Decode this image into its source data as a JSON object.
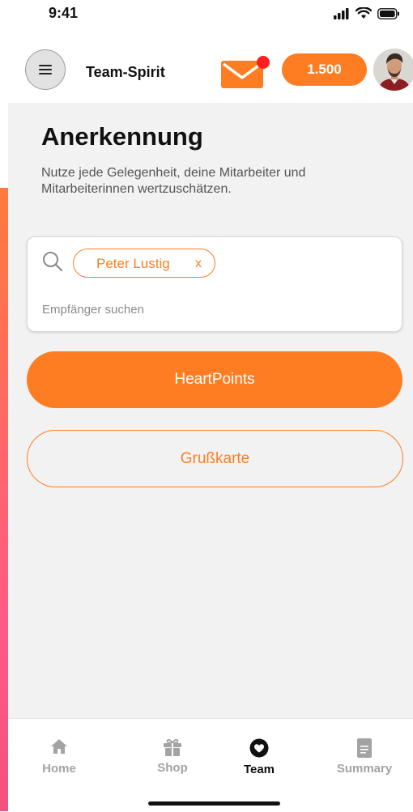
{
  "status_bar": {
    "time": "9:41"
  },
  "header": {
    "app_title": "Team-Spirit",
    "points_balance": "1.500",
    "has_unread_mail": true
  },
  "page": {
    "title": "Anerkennung",
    "description": "Nutze jede Gelegenheit, deine Mitarbeiter und Mitarbeiterinnen wertzuschätzen."
  },
  "recipient_search": {
    "selected_chip": {
      "label": "Peter Lustig",
      "remove": "x"
    },
    "placeholder": "Empfänger suchen",
    "value": ""
  },
  "actions": {
    "primary_label": "HeartPoints",
    "secondary_label": "Grußkarte"
  },
  "bottom_nav": {
    "items": [
      {
        "label": "Home",
        "icon": "home-icon",
        "active": false
      },
      {
        "label": "Shop",
        "icon": "gift-icon",
        "active": false
      },
      {
        "label": "Team",
        "icon": "heart-icon",
        "active": true
      },
      {
        "label": "Summary",
        "icon": "document-icon",
        "active": false
      }
    ]
  },
  "colors": {
    "accent": "#ff7d22",
    "notification": "#ff1f1f",
    "surface": "#f2f2f2",
    "inactive_nav": "#a3a3a3"
  }
}
